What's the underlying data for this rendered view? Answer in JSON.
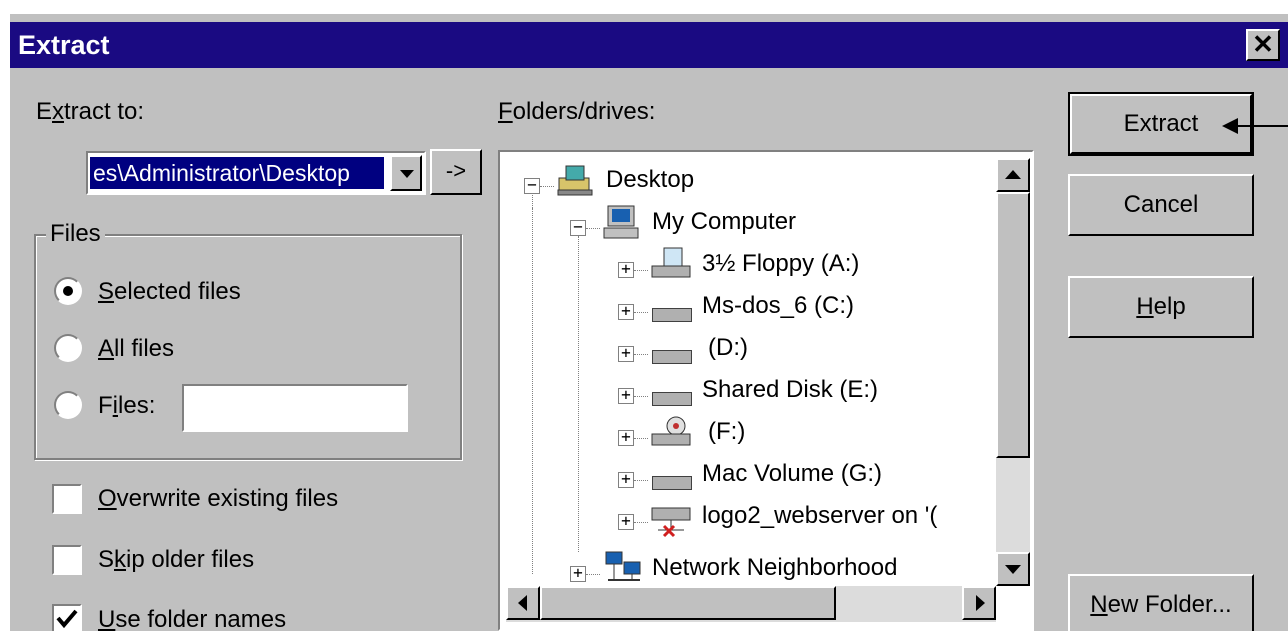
{
  "dialog": {
    "title": "Extract",
    "close_label": "✕"
  },
  "extract_to": {
    "label_pre": "E",
    "label_u": "x",
    "label_post": "tract to:",
    "value": "es\\Administrator\\Desktop",
    "go_label": "->"
  },
  "files_group": {
    "label": "Files",
    "selected_u": "S",
    "selected_rest": "elected files",
    "all_u": "A",
    "all_rest": "ll files",
    "files_pre": "F",
    "files_u": "i",
    "files_post": "les:",
    "selected_option": "Selected files"
  },
  "options": {
    "overwrite_u": "O",
    "overwrite_rest": "verwrite existing files",
    "overwrite_checked": false,
    "skip_pre": "S",
    "skip_u": "k",
    "skip_post": "ip older files",
    "skip_checked": false,
    "folder_u": "U",
    "folder_rest": "se folder names",
    "folder_checked": true
  },
  "folders": {
    "label_u": "F",
    "label_rest": "olders/drives:",
    "items": [
      {
        "label": "Desktop",
        "expander": "−",
        "icon": "desktop-icon"
      },
      {
        "label": "My Computer",
        "expander": "−",
        "icon": "computer-icon"
      },
      {
        "label": "3½ Floppy (A:)",
        "expander": "+",
        "icon": "floppy-icon"
      },
      {
        "label": "Ms-dos_6 (C:)",
        "expander": "+",
        "icon": "drive-icon"
      },
      {
        "label": "(D:)",
        "expander": "+",
        "icon": "drive-icon"
      },
      {
        "label": "Shared Disk (E:)",
        "expander": "+",
        "icon": "drive-icon"
      },
      {
        "label": "(F:)",
        "expander": "+",
        "icon": "cd-icon"
      },
      {
        "label": "Mac Volume (G:)",
        "expander": "+",
        "icon": "drive-icon"
      },
      {
        "label": "logo2_webserver on '(",
        "expander": "+",
        "icon": "network-drive-icon"
      },
      {
        "label": "Network Neighborhood",
        "expander": "+",
        "icon": "network-icon"
      }
    ]
  },
  "buttons": {
    "extract": "Extract",
    "cancel": "Cancel",
    "help_u": "H",
    "help_rest": "elp",
    "new_folder_u": "N",
    "new_folder_rest": "ew Folder..."
  }
}
